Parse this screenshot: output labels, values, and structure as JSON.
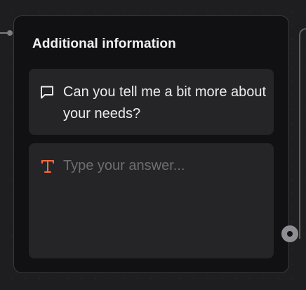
{
  "card": {
    "title": "Additional information",
    "question": {
      "icon": "message-square-icon",
      "text": "Can you tell me a bit more about your needs?"
    },
    "answer": {
      "icon": "text-type-icon",
      "placeholder": "Type your answer..."
    }
  },
  "colors": {
    "canvas": "#1e1e20",
    "card": "#111113",
    "panel": "#252528",
    "accent": "#ff6a3d"
  }
}
